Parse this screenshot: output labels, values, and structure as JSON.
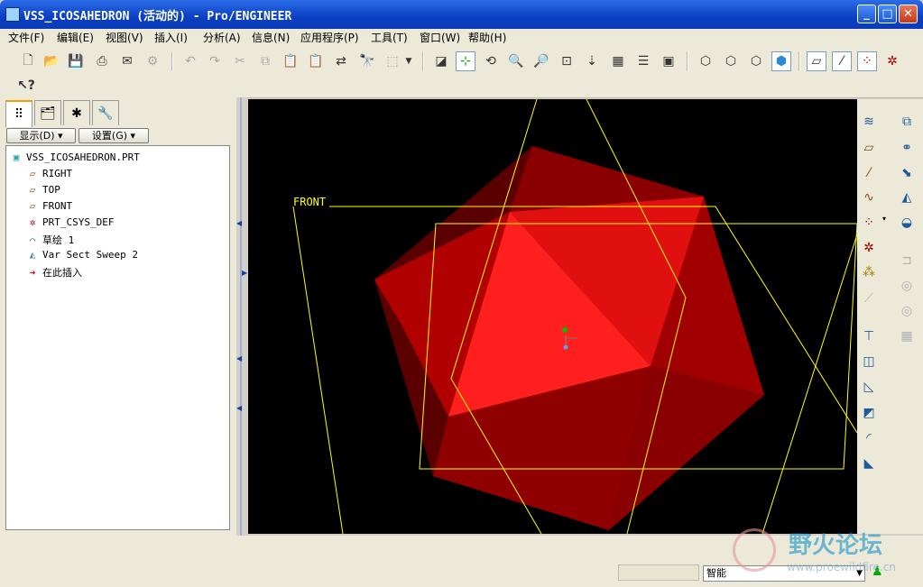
{
  "window": {
    "title": "VSS_ICOSAHEDRON (活动的) - Pro/ENGINEER",
    "buttons": [
      "minimize-icon",
      "maximize-icon",
      "close-icon"
    ]
  },
  "menu": [
    "文件(F)",
    "编辑(E)",
    "视图(V)",
    "插入(I)",
    "分析(A)",
    "信息(N)",
    "应用程序(P)",
    "工具(T)",
    "窗口(W)",
    "帮助(H)"
  ],
  "toolbar": {
    "icons": [
      "new-icon",
      "open-icon",
      "save-icon",
      "print-icon",
      "send-mail-icon",
      "regen-icon",
      "undo-icon",
      "redo-icon",
      "cut-icon",
      "copy-icon",
      "paste-icon",
      "paste-special-icon",
      "regenerate-icon",
      "find-icon",
      "select-box-icon",
      "redraw-icon",
      "spin-center-icon",
      "orient-mode-icon",
      "zoom-in-icon",
      "zoom-out-icon",
      "refit-icon",
      "reorient-icon",
      "view-manager-icon",
      "layers-icon",
      "saved-views-icon",
      "wireframe-icon",
      "hidden-line-icon",
      "no-hidden-icon",
      "shading-icon",
      "datum-plane-display-icon",
      "datum-axis-display-icon",
      "datum-point-display-icon",
      "csys-display-icon"
    ],
    "whats_this_icon": "whats-this-icon"
  },
  "left_panel": {
    "tabs": [
      "model-tree-tab-icon",
      "folder-browser-tab-icon",
      "favorites-tab-icon",
      "connections-tab-icon"
    ],
    "show_button": "显示(D)",
    "settings_button": "设置(G)",
    "tree": [
      {
        "label": "VSS_ICOSAHEDRON.PRT",
        "icon": "part-icon"
      },
      {
        "label": "RIGHT",
        "icon": "datum-plane-icon"
      },
      {
        "label": "TOP",
        "icon": "datum-plane-icon"
      },
      {
        "label": "FRONT",
        "icon": "datum-plane-icon"
      },
      {
        "label": "PRT_CSYS_DEF",
        "icon": "csys-icon"
      },
      {
        "label": "草绘 1",
        "icon": "sketch-icon"
      },
      {
        "label": "Var Sect Sweep 2",
        "icon": "sweep-icon"
      },
      {
        "label": "在此插入",
        "icon": "insert-here-arrow-icon"
      }
    ]
  },
  "viewport": {
    "datum_label": "FRONT",
    "background": "#000000",
    "model_color": "#ff1a1a",
    "datum_color": "#ffff00"
  },
  "right_tools": [
    "datum-curve-icon",
    "datum-plane-icon",
    "datum-axis-icon",
    "sketched-curve-icon",
    "datum-point-icon",
    "datum-csys-icon",
    "analysis-feature-icon",
    "extrude-icon",
    "revolve-icon",
    "sweep-blend-icon",
    "boundary-blend-icon",
    "mirror-icon",
    "merge-icon",
    "trim-icon",
    "pattern-icon",
    "hole-icon",
    "shell-icon",
    "rib-icon",
    "draft-icon",
    "round-icon",
    "chamfer-icon"
  ],
  "status": {
    "filter_value": "智能"
  },
  "watermark": {
    "text": "野火论坛",
    "url": "www.proewildfire.cn"
  }
}
